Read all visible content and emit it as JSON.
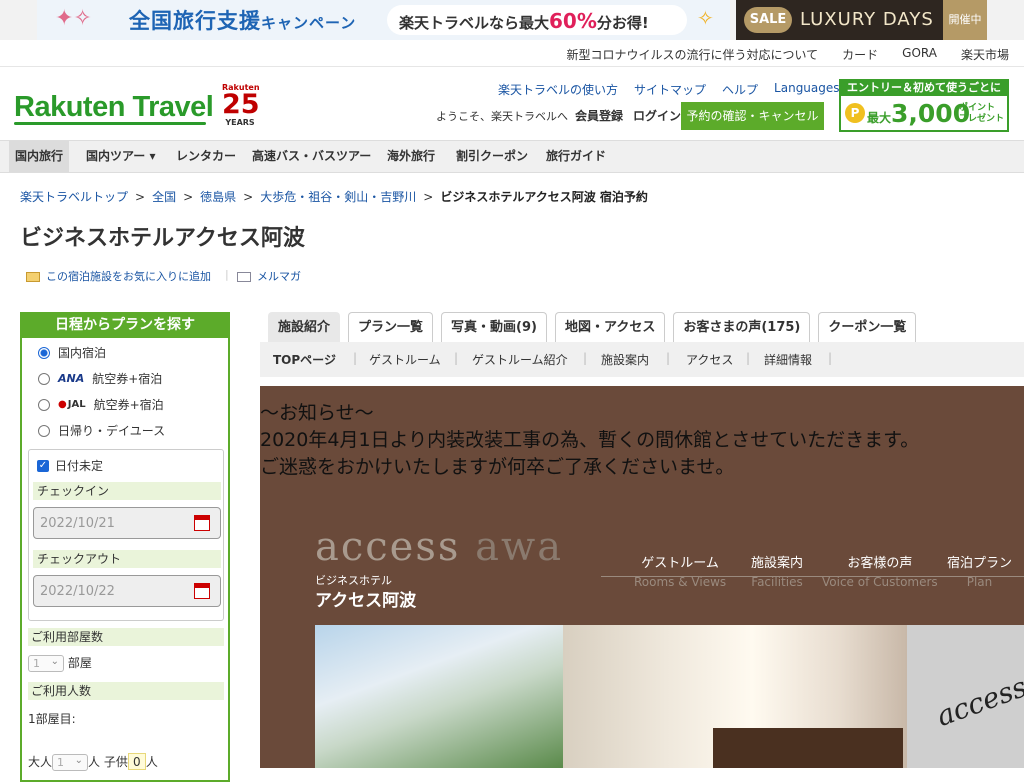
{
  "banner": {
    "campaign_title": "全国旅行支援",
    "campaign_sub": "キャンペーン",
    "pill_prefix": "楽天トラベルなら最大",
    "pill_pct": "60%",
    "pill_suffix": "分お得!",
    "sale": "SALE",
    "luxury": "LUXURY DAYS",
    "open": "開催中"
  },
  "toplinks": [
    "新型コロナウイルスの流行に伴う対応について",
    "カード",
    "GORA",
    "楽天市場"
  ],
  "header": {
    "logo": "Rakuten Travel",
    "badge_top": "Rakuten",
    "badge_num": "25",
    "badge_bottom": "YEARS",
    "links": [
      "楽天トラベルの使い方",
      "サイトマップ",
      "ヘルプ"
    ],
    "languages": "Languages",
    "welcome": "ようこそ、楽天トラベルへ",
    "register": "会員登録",
    "login": "ログイン",
    "reserve_btn": "予約の確認・キャンセル",
    "promo_top": "エントリー＆初めて使うごとに",
    "promo_max": "最大",
    "promo_amount": "3,000",
    "promo_pt1": "ポイント",
    "promo_pt2": "プレゼント",
    "coin": "P"
  },
  "nav": [
    "国内旅行",
    "国内ツアー ▾",
    "レンタカー",
    "高速バス・バスツアー",
    "海外旅行",
    "割引クーポン",
    "旅行ガイド"
  ],
  "breadcrumb": {
    "items": [
      "楽天トラベルトップ",
      "全国",
      "徳島県",
      "大歩危・祖谷・剣山・吉野川"
    ],
    "current": "ビジネスホテルアクセス阿波 宿泊予約"
  },
  "hotel": {
    "title": "ビジネスホテルアクセス阿波",
    "fav": "この宿泊施設をお気に入りに追加",
    "mail": "メルマガ"
  },
  "search": {
    "head": "日程からプランを探す",
    "opt1": "国内宿泊",
    "ana": "ANA",
    "jal": "JAL",
    "air": "航空券+宿泊",
    "opt4": "日帰り・デイユース",
    "undecided": "日付未定",
    "checkin_label": "チェックイン",
    "checkin": "2022/10/21",
    "checkout_label": "チェックアウト",
    "checkout": "2022/10/22",
    "rooms_label": "ご利用部屋数",
    "rooms": "1",
    "rooms_unit": "部屋",
    "people_label": "ご利用人数",
    "room1": "1部屋目:",
    "adult": "大人",
    "adults": "1",
    "person": "人",
    "child": "子供",
    "children": "0"
  },
  "tabs": [
    "施設紹介",
    "プラン一覧",
    "写真・動画(9)",
    "地図・アクセス",
    "お客さまの声(175)",
    "クーポン一覧"
  ],
  "subnav": [
    "TOPページ",
    "ゲストルーム",
    "ゲストルーム紹介",
    "施設案内",
    "アクセス",
    "詳細情報"
  ],
  "notice": {
    "l1": "〜お知らせ〜",
    "l2": "2020年4月1日より内装改装工事の為、暫くの間休館とさせていただきます。",
    "l3": "ご迷惑をおかけいたしますが何卒ご了承くださいませ。"
  },
  "hero": {
    "brand1": "access",
    "brand2": " awa",
    "bh": "ビジネスホテル",
    "bn": "アクセス阿波",
    "photo_text": "access",
    "menu": [
      {
        "jp": "ゲストルーム",
        "en": "Rooms & Views"
      },
      {
        "jp": "施設案内",
        "en": "Facilities"
      },
      {
        "jp": "お客様の声",
        "en": "Voice of Customers"
      },
      {
        "jp": "宿泊プラン",
        "en": "Plan"
      }
    ]
  }
}
